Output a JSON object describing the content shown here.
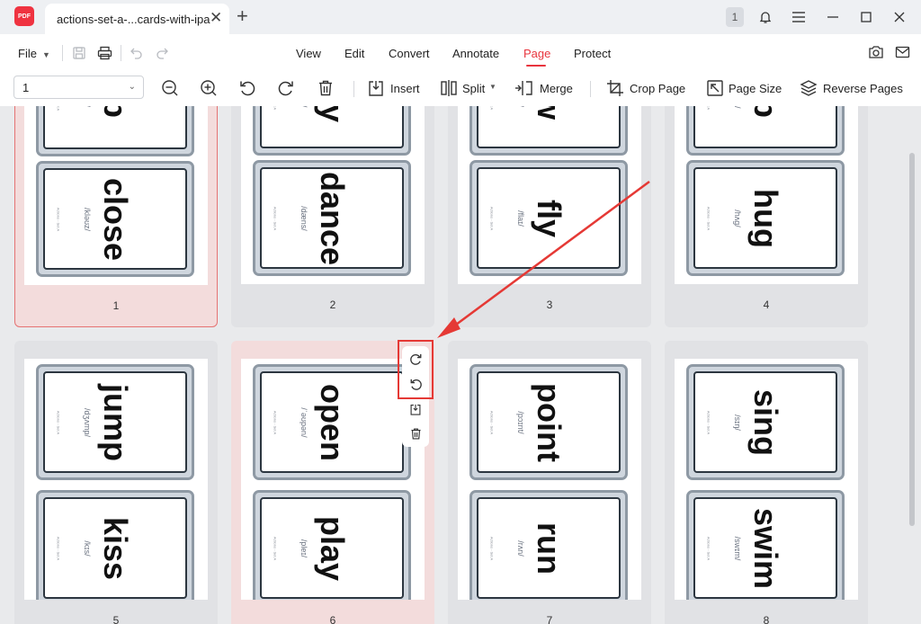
{
  "app": {
    "logo_text": "PDF",
    "tab_title": "actions-set-a-...cards-with-ipa",
    "tab_close": "✕",
    "new_tab": "+",
    "badge": "1",
    "accent_color": "#e8343d"
  },
  "menubar": {
    "file_label": "File",
    "items": [
      "View",
      "Edit",
      "Convert",
      "Annotate",
      "Page",
      "Protect"
    ],
    "active": "Page"
  },
  "toolbar": {
    "page_value": "1",
    "insert_label": "Insert",
    "split_label": "Split",
    "merge_label": "Merge",
    "crop_label": "Crop Page",
    "size_label": "Page Size",
    "reverse_label": "Reverse Pages"
  },
  "pages": [
    {
      "number": "1",
      "selected": true,
      "cards": [
        {
          "word": "ap",
          "ipa": "/æp/"
        },
        {
          "word": "close",
          "ipa": "/kləʊz/"
        }
      ]
    },
    {
      "number": "2",
      "cards": [
        {
          "word": "cry",
          "ipa": "/kraɪ/"
        },
        {
          "word": "dance",
          "ipa": "/dæns/"
        }
      ]
    },
    {
      "number": "3",
      "cards": [
        {
          "word": "aw",
          "ipa": "/drɔː/"
        },
        {
          "word": "fly",
          "ipa": "/flaɪ/"
        }
      ]
    },
    {
      "number": "4",
      "cards": [
        {
          "word": "op",
          "ipa": "/drɒp/"
        },
        {
          "word": "hug",
          "ipa": "/hʌɡ/"
        }
      ]
    },
    {
      "number": "5",
      "cards": [
        {
          "word": "jump",
          "ipa": "/dʒʌmp/"
        },
        {
          "word": "kiss",
          "ipa": "/kɪs/"
        }
      ]
    },
    {
      "number": "6",
      "hovered": true,
      "cards": [
        {
          "word": "open",
          "ipa": "/ˈəʊpən/"
        },
        {
          "word": "play",
          "ipa": "/pleɪ/"
        }
      ]
    },
    {
      "number": "7",
      "cards": [
        {
          "word": "point",
          "ipa": "/pɔɪnt/"
        },
        {
          "word": "run",
          "ipa": "/rʌn/"
        }
      ]
    },
    {
      "number": "8",
      "cards": [
        {
          "word": "sing",
          "ipa": "/sɪŋ/"
        },
        {
          "word": "swim",
          "ipa": "/swɪm/"
        }
      ]
    }
  ],
  "card_footer": "Actions - Set A",
  "annotation_color": "#e53935"
}
